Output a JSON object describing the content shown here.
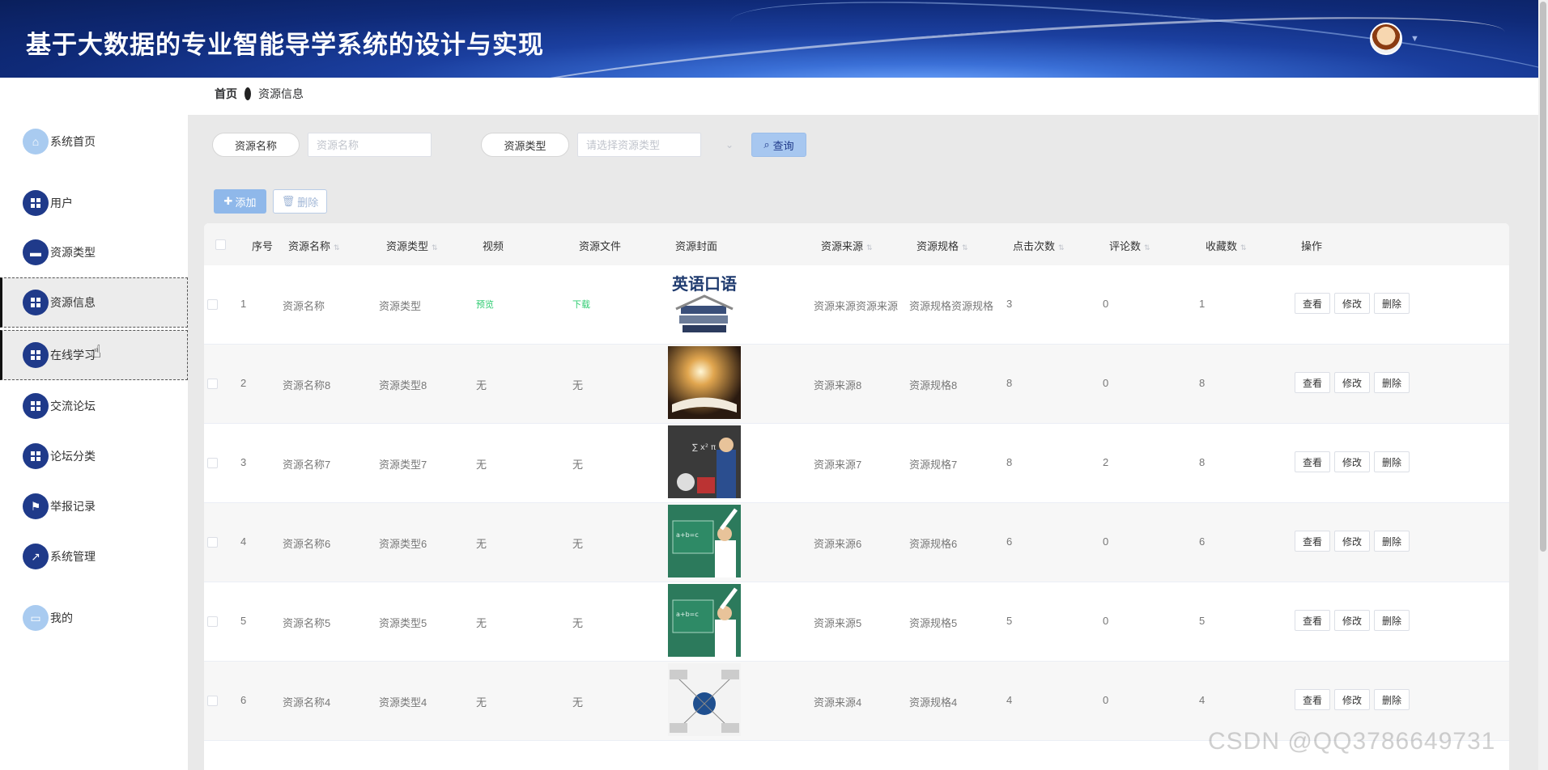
{
  "header": {
    "title": "基于大数据的专业智能导学系统的设计与实现"
  },
  "breadcrumb": {
    "home": "首页",
    "current": "资源信息"
  },
  "sidebar": {
    "items": [
      {
        "label": "系统首页",
        "icon": "home-icon"
      },
      {
        "label": "用户",
        "icon": "grid-icon"
      },
      {
        "label": "资源类型",
        "icon": "book-icon"
      },
      {
        "label": "资源信息",
        "icon": "grid-icon"
      },
      {
        "label": "在线学习",
        "icon": "grid-icon"
      },
      {
        "label": "交流论坛",
        "icon": "grid-icon"
      },
      {
        "label": "论坛分类",
        "icon": "grid-icon"
      },
      {
        "label": "举报记录",
        "icon": "flag-icon"
      },
      {
        "label": "系统管理",
        "icon": "chart-icon"
      },
      {
        "label": "我的",
        "icon": "card-icon"
      }
    ]
  },
  "search": {
    "name_label": "资源名称",
    "name_placeholder": "资源名称",
    "type_label": "资源类型",
    "type_placeholder": "请选择资源类型",
    "query_label": "查询"
  },
  "toolbar": {
    "add_label": "添加",
    "delete_label": "删除"
  },
  "table": {
    "headers": [
      "序号",
      "资源名称",
      "资源类型",
      "视频",
      "资源文件",
      "资源封面",
      "资源来源",
      "资源规格",
      "点击次数",
      "评论数",
      "收藏数",
      "操作"
    ],
    "actions": {
      "view": "查看",
      "edit": "修改",
      "delete": "删除"
    },
    "rows": [
      {
        "index": "1",
        "name": "资源名称",
        "type": "资源类型",
        "video": "预览",
        "file": "下载",
        "source": "资源来源资源来源",
        "spec": "资源规格资源规格",
        "clicks": "3",
        "comments": "0",
        "favorites": "1",
        "cover": "cover-book"
      },
      {
        "index": "2",
        "name": "资源名称8",
        "type": "资源类型8",
        "video": "无",
        "file": "无",
        "source": "资源来源8",
        "spec": "资源规格8",
        "clicks": "8",
        "comments": "0",
        "favorites": "8",
        "cover": "cover-light"
      },
      {
        "index": "3",
        "name": "资源名称7",
        "type": "资源类型7",
        "video": "无",
        "file": "无",
        "source": "资源来源7",
        "spec": "资源规格7",
        "clicks": "8",
        "comments": "2",
        "favorites": "8",
        "cover": "cover-blackboard"
      },
      {
        "index": "4",
        "name": "资源名称6",
        "type": "资源类型6",
        "video": "无",
        "file": "无",
        "source": "资源来源6",
        "spec": "资源规格6",
        "clicks": "6",
        "comments": "0",
        "favorites": "6",
        "cover": "cover-green"
      },
      {
        "index": "5",
        "name": "资源名称5",
        "type": "资源类型5",
        "video": "无",
        "file": "无",
        "source": "资源来源5",
        "spec": "资源规格5",
        "clicks": "5",
        "comments": "0",
        "favorites": "5",
        "cover": "cover-green"
      },
      {
        "index": "6",
        "name": "资源名称4",
        "type": "资源类型4",
        "video": "无",
        "file": "无",
        "source": "资源来源4",
        "spec": "资源规格4",
        "clicks": "4",
        "comments": "0",
        "favorites": "4",
        "cover": "cover-mindmap"
      }
    ]
  },
  "watermark": "CSDN @QQ3786649731"
}
